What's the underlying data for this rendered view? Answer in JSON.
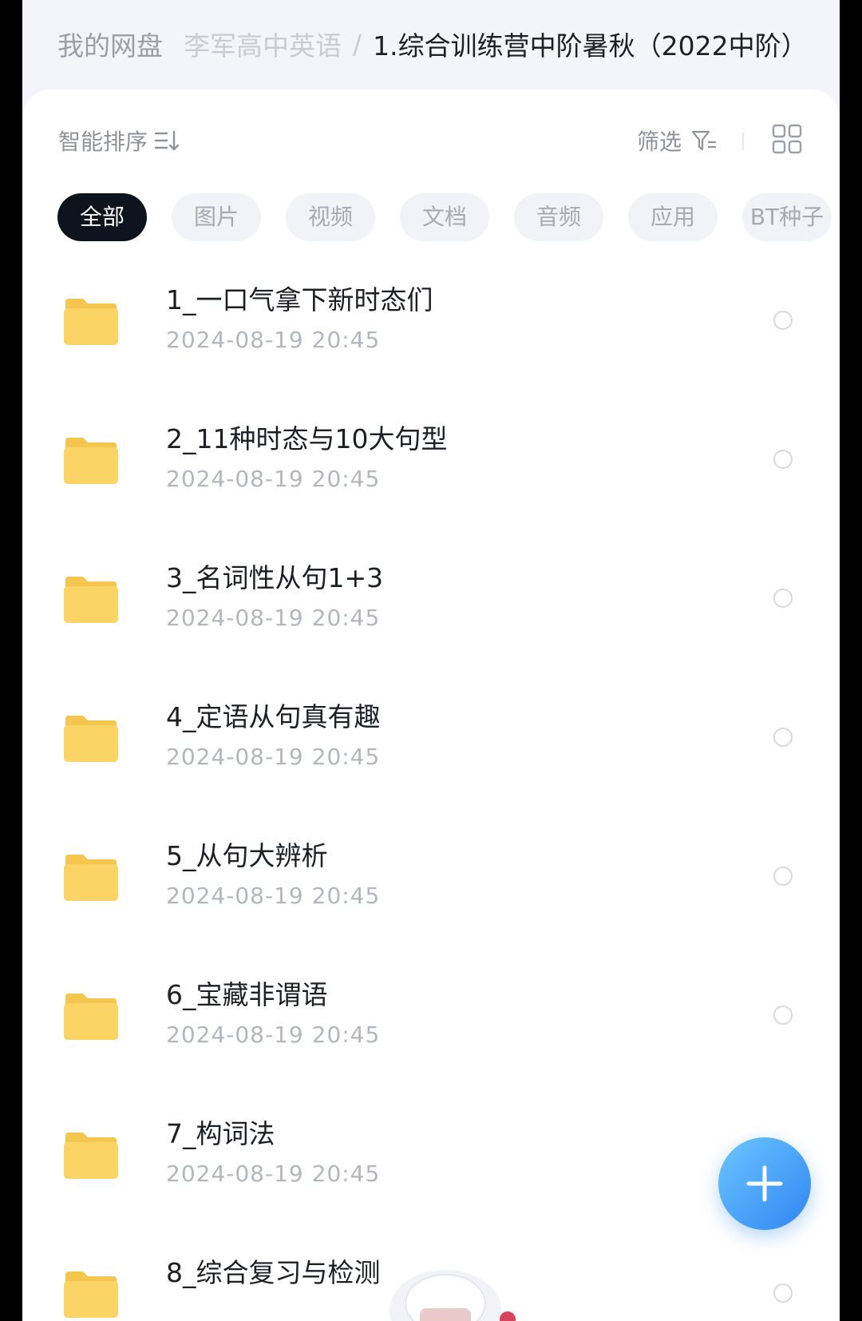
{
  "breadcrumb": {
    "root": "我的网盘",
    "middle": "李军高中英语",
    "separator": "/",
    "current": "1.综合训练营中阶暑秋（2022中阶）"
  },
  "toolbar": {
    "sort_label": "智能排序",
    "sort_icon": "sort-lines-icon",
    "filter_label": "筛选",
    "filter_icon": "funnel-icon",
    "view_icon": "grid-view-icon"
  },
  "tabs": [
    {
      "label": "全部",
      "active": true
    },
    {
      "label": "图片",
      "active": false
    },
    {
      "label": "视频",
      "active": false
    },
    {
      "label": "文档",
      "active": false
    },
    {
      "label": "音频",
      "active": false
    },
    {
      "label": "应用",
      "active": false
    },
    {
      "label": "BT种子",
      "active": false
    }
  ],
  "files": [
    {
      "name": "1_一口气拿下新时态们",
      "date": "2024-08-19  20:45"
    },
    {
      "name": "2_11种时态与10大句型",
      "date": "2024-08-19  20:45"
    },
    {
      "name": "3_名词性从句1+3",
      "date": "2024-08-19  20:45"
    },
    {
      "name": "4_定语从句真有趣",
      "date": "2024-08-19  20:45"
    },
    {
      "name": "5_从句大辨析",
      "date": "2024-08-19  20:45"
    },
    {
      "name": "6_宝藏非谓语",
      "date": "2024-08-19  20:45"
    },
    {
      "name": "7_构词法",
      "date": "2024-08-19  20:45"
    },
    {
      "name": "8_综合复习与检测",
      "date": ""
    }
  ],
  "fab": {
    "icon": "plus-icon"
  },
  "colors": {
    "active_tab_bg": "#0d141d",
    "folder_yellow": "#f9d25f",
    "fab_blue": "#2f86f2"
  }
}
